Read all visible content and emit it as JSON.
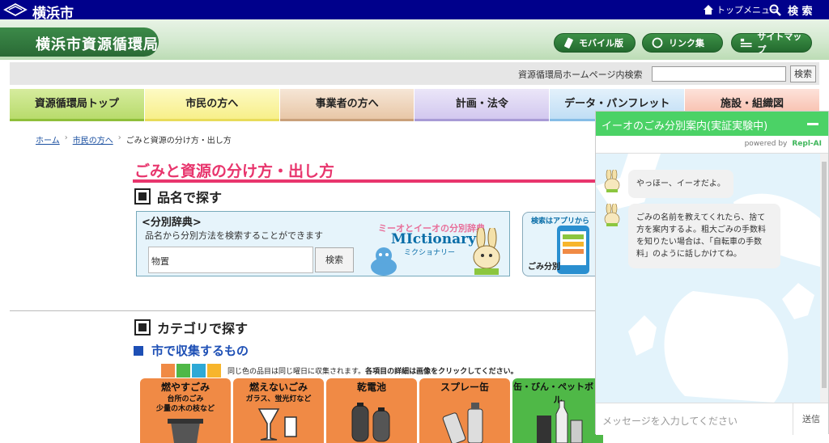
{
  "citybar": {
    "city_name": "横浜市",
    "top_menu_label": "トップメニュー",
    "search_label": "検 索",
    "bg_color": "#00008b"
  },
  "header": {
    "bureau_name": "横浜市資源循環局",
    "buttons": [
      {
        "label": "モバイル版",
        "icon": "mobile-icon"
      },
      {
        "label": "リンク集",
        "icon": "link-icon"
      },
      {
        "label": "サイトマップ",
        "icon": "sitemap-icon"
      }
    ],
    "accent_color": "#2e7d3a"
  },
  "site_search": {
    "label": "資源循環局ホームページ内検索",
    "input_value": "",
    "button_label": "検索"
  },
  "nav": {
    "tabs": [
      {
        "label": "資源循環局トップ",
        "color": "#c7e38b"
      },
      {
        "label": "市民の方へ",
        "color": "#fbf5a8"
      },
      {
        "label": "事業者の方へ",
        "color": "#f0d9c3"
      },
      {
        "label": "計画・法令",
        "color": "#dcd5f2"
      },
      {
        "label": "データ・パンフレット",
        "color": "#cfe6f7"
      },
      {
        "label": "施設・組織図",
        "color": "#f9cbbf"
      }
    ]
  },
  "breadcrumb": {
    "items": [
      "ホーム",
      "市民の方へ",
      "ごみと資源の分け方・出し方"
    ]
  },
  "main": {
    "page_title": "ごみと資源の分け方・出し方",
    "section_search_by_name": "品名で探す",
    "dictionary": {
      "heading": "<分別辞典>",
      "description": "品名から分別方法を検索することができます",
      "input_value": "物置",
      "button_label": "検索",
      "brand_tagline": "ミーオとイーオの分別辞典",
      "brand_name": "MIctionary",
      "brand_reading": "ミクショナリー"
    },
    "app_banner": {
      "text": "検索はアプリから",
      "logo_text": "ごみ分別"
    },
    "section_by_category": "カテゴリで探す",
    "sub_section_city": "市で収集するもの",
    "legend": {
      "colors": [
        "#f08a45",
        "#4fb847",
        "#2ea9d6",
        "#f7b52c"
      ],
      "note_plain": "同じ色の品目は同じ曜日に収集されます。",
      "note_bold": "各項目の詳細は画像をクリックしてください。"
    },
    "categories": [
      {
        "name": "燃やすごみ",
        "sub1": "台所のごみ",
        "sub2": "少量の木の枝など",
        "color": "#f08a45"
      },
      {
        "name": "燃えないごみ",
        "sub1": "ガラス、蛍光灯など",
        "sub2": "",
        "color": "#f08a45"
      },
      {
        "name": "乾電池",
        "sub1": "",
        "sub2": "",
        "color": "#f08a45"
      },
      {
        "name": "スプレー缶",
        "sub1": "",
        "sub2": "",
        "color": "#f08a45"
      },
      {
        "name": "缶・びん・ペットボトル",
        "sub1": "",
        "sub2": "",
        "color": "#4fb847"
      }
    ]
  },
  "chat": {
    "title": "イーオのごみ分別案内(実証実験中)",
    "powered_by": "powered by",
    "provider": "Repl-AI",
    "messages": [
      "やっほー、イーオだよ。",
      "ごみの名前を教えてくれたら、捨て方を案内するよ。粗大ごみの手数料を知りたい場合は、「自転車の手数料」のように話しかけてね。"
    ],
    "input_placeholder": "メッセージを入力してください",
    "send_label": "送信",
    "header_color": "#4bd266"
  }
}
